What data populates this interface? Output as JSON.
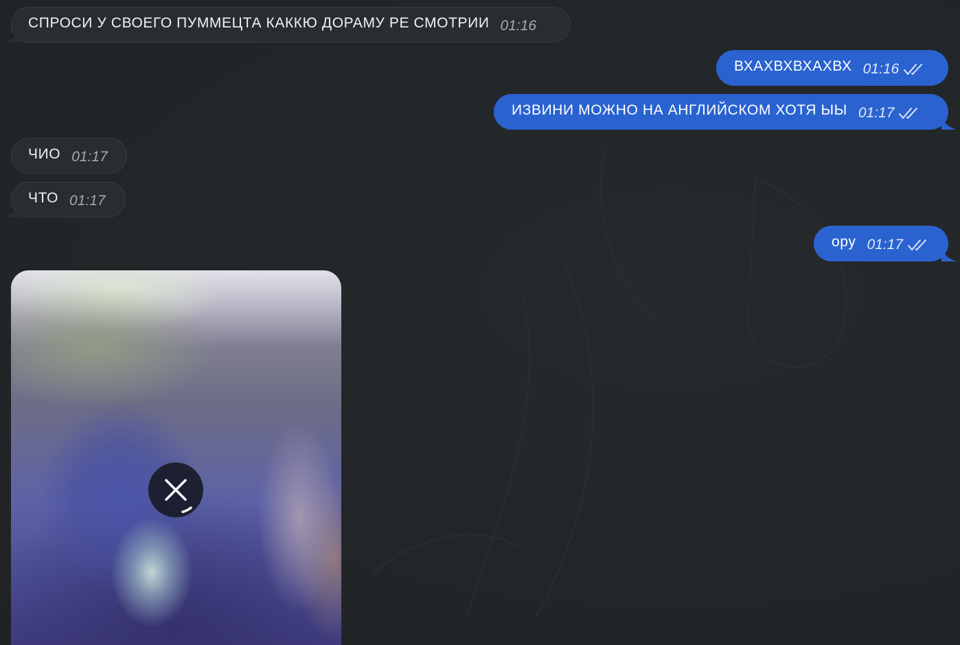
{
  "chat": {
    "messages": [
      {
        "direction": "in",
        "text": "СПРОСИ У СВОЕГО ПУММЕЦТА КАККЮ ДОРАМУ РЕ СМОТРИИ",
        "time": "01:16"
      },
      {
        "direction": "out",
        "text": "ВХАХВХВХАХВХ",
        "time": "01:16",
        "status": "read"
      },
      {
        "direction": "out",
        "text": "ИЗВИНИ МОЖНО НА АНГЛИЙСКОМ ХОТЯ ЫЫ",
        "time": "01:17",
        "status": "read"
      },
      {
        "direction": "in",
        "text": "ЧИО",
        "time": "01:17"
      },
      {
        "direction": "in",
        "text": "ЧТО",
        "time": "01:17"
      },
      {
        "direction": "out",
        "text": "ору",
        "time": "01:17",
        "status": "read"
      }
    ],
    "media_message": {
      "direction": "in",
      "type": "video",
      "state": "downloading",
      "cancel_icon": "close-icon"
    }
  },
  "colors": {
    "background": "#222628",
    "incoming_bubble": "#2a2d30",
    "outgoing_bubble": "#2a63d0",
    "incoming_time": "#a5a8ab",
    "outgoing_time": "#dfe7f8"
  },
  "icons": {
    "read_status": "double-check-icon",
    "cancel_download": "close-icon"
  }
}
